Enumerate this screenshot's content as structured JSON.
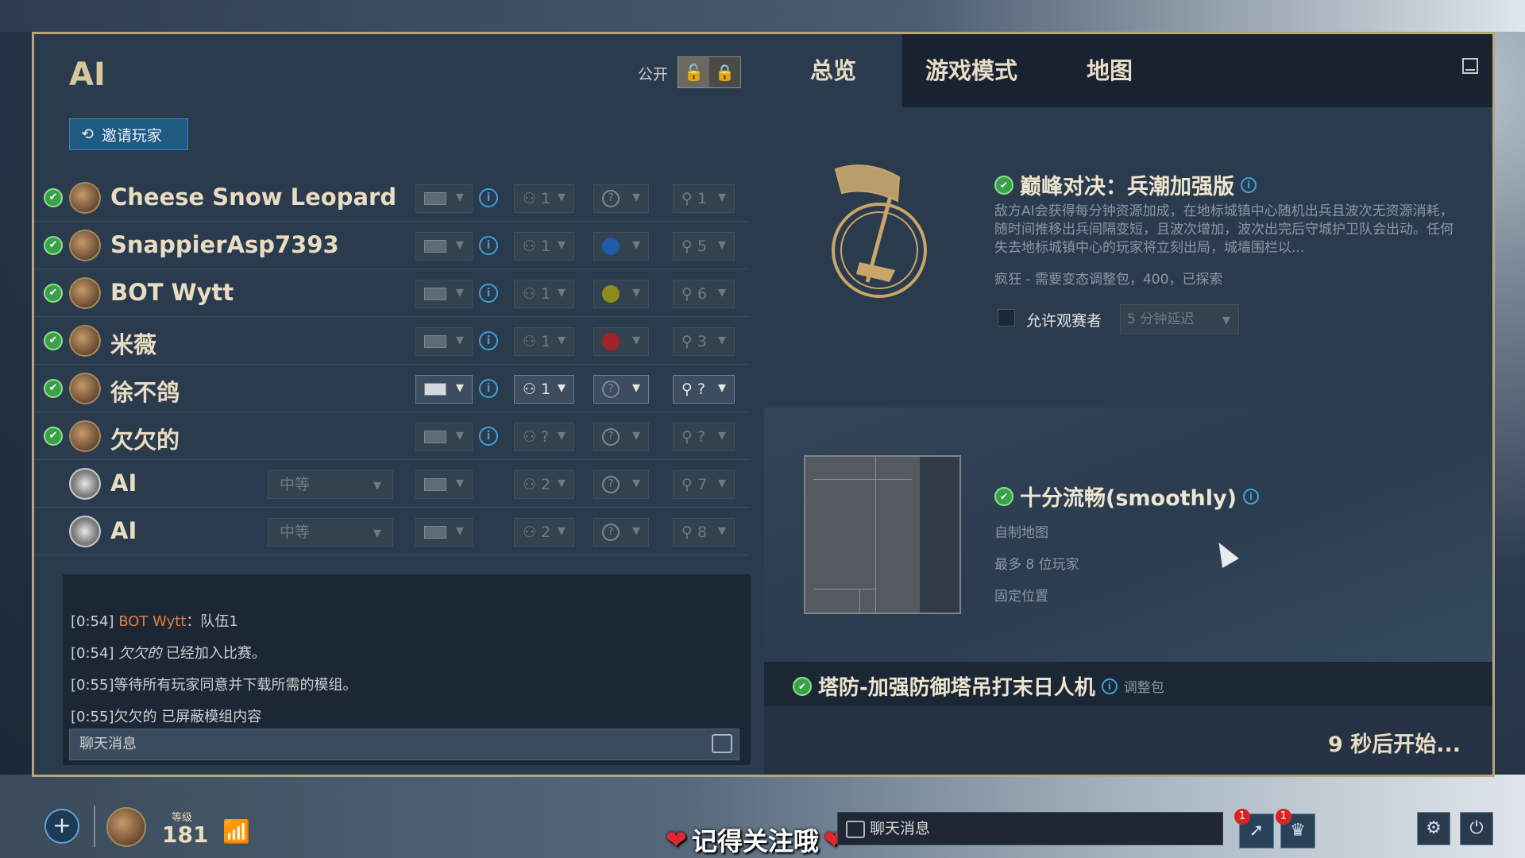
{
  "lobby": {
    "title": "AI",
    "public_label": "公开",
    "invite_label": "邀请玩家",
    "players": [
      {
        "name": "Cheese Snow Leopard",
        "team": "1",
        "color": "?",
        "slot": "1",
        "ready": true,
        "ai": false,
        "active": false
      },
      {
        "name": "SnappierAsp7393",
        "team": "1",
        "color": "blue",
        "slot": "5",
        "ready": true,
        "ai": false,
        "active": false
      },
      {
        "name": "BOT Wytt",
        "team": "1",
        "color": "olive",
        "slot": "6",
        "ready": true,
        "ai": false,
        "active": false
      },
      {
        "name": "米薇",
        "team": "1",
        "color": "red",
        "slot": "3",
        "ready": true,
        "ai": false,
        "active": false
      },
      {
        "name": "徐不鸽",
        "team": "1",
        "color": "?",
        "slot": "?",
        "ready": true,
        "ai": false,
        "active": true
      },
      {
        "name": "欠欠的",
        "team": "?",
        "color": "?",
        "slot": "?",
        "ready": true,
        "ai": false,
        "active": false
      },
      {
        "name": "AI",
        "difficulty": "中等",
        "team": "2",
        "color": "?",
        "slot": "7",
        "ready": false,
        "ai": true,
        "active": false
      },
      {
        "name": "AI",
        "difficulty": "中等",
        "team": "2",
        "color": "?",
        "slot": "8",
        "ready": false,
        "ai": true,
        "active": false
      }
    ]
  },
  "chat": {
    "lines": [
      {
        "time": "[0:54]",
        "speaker": "BOT Wytt",
        "text": "：队伍1"
      },
      {
        "time": "[0:54]",
        "speaker": "欠欠的",
        "text": "已经加入比赛。"
      },
      {
        "time": "[0:55]",
        "speaker": "",
        "text": "等待所有玩家同意并下载所需的模组。"
      },
      {
        "time": "[0:55]",
        "speaker": "",
        "text": "欠欠的 已屏蔽模组内容"
      }
    ],
    "input_placeholder": "聊天消息"
  },
  "tabs": [
    "总览",
    "游戏模式",
    "地图"
  ],
  "game_mode": {
    "title": "巅峰对决：兵潮加强版",
    "description": "敌方AI会获得每分钟资源加成，在地标城镇中心随机出兵且波次无资源消耗，随时间推移出兵间隔变短，且波次增加，波次出完后守城护卫队会出动。任何失去地标城镇中心的玩家将立刻出局，城墙围栏以...",
    "meta": "疯狂 - 需要变态调整包，400，已探索",
    "spectators_label": "允许观赛者",
    "delay_value": "5 分钟延迟"
  },
  "map": {
    "title": "十分流畅(smoothly)",
    "type": "自制地图",
    "players": "最多 8 位玩家",
    "positions": "固定位置"
  },
  "mod": {
    "title": "塔防-加强防御塔吊打末日人机",
    "tag": "调整包"
  },
  "countdown": "9 秒后开始...",
  "footer": {
    "level_label": "等级",
    "level_value": "181",
    "overlay_text": "记得关注哦",
    "chat_placeholder": "聊天消息",
    "badge_1": "1",
    "badge_2": "1"
  },
  "colors": {
    "frame": "#b9a57a",
    "accent_blue": "#3f9fd8",
    "ready_green": "#3aa04a",
    "highlight_orange": "#e2803a"
  }
}
